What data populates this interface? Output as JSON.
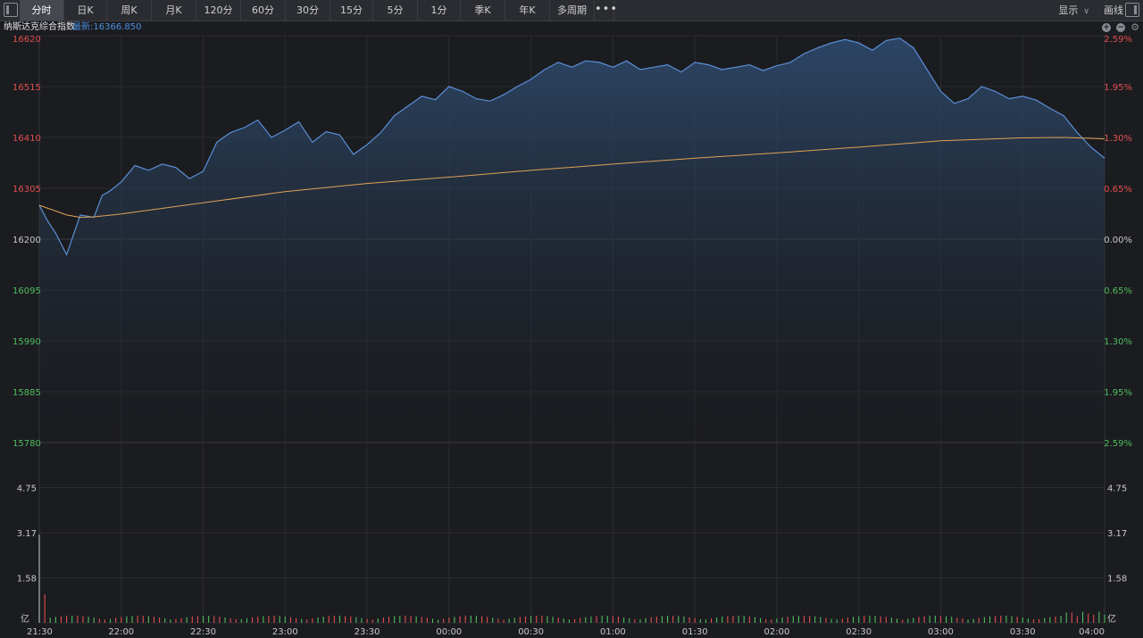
{
  "toolbar": {
    "tabs": [
      "分时",
      "日K",
      "周K",
      "月K",
      "120分",
      "60分",
      "30分",
      "15分",
      "5分",
      "1分",
      "季K",
      "年K",
      "多周期"
    ],
    "active_tab": "分时",
    "more_icon": "more-dots-icon",
    "display_label": "显示",
    "draw_label": "画线"
  },
  "info": {
    "index_name": "纳斯达克综合指数",
    "latest_label": "最新:16366.850"
  },
  "colors": {
    "background": "#1b1c20",
    "price_line": "#5b8fd6",
    "avg_line": "#e0a257",
    "up": "#e14f4f",
    "down": "#4fbe5f",
    "axis_text": "#c8c8c8",
    "latest_text": "#4a90e2"
  },
  "chart_data": {
    "type": "line",
    "title": "纳斯达克综合指数",
    "x_ticks": [
      "21:30",
      "22:00",
      "22:30",
      "23:00",
      "23:30",
      "00:00",
      "00:30",
      "01:00",
      "01:30",
      "02:00",
      "02:30",
      "03:00",
      "03:30",
      "04:00"
    ],
    "x_range": [
      "21:30",
      "04:00"
    ],
    "price_ticks": [
      "16620",
      "16515",
      "16410",
      "16305",
      "16200",
      "16095",
      "15990",
      "15885",
      "15780"
    ],
    "percent_ticks": [
      "2.59%",
      "1.95%",
      "1.30%",
      "0.65%",
      "0.00%",
      "0.65%",
      "1.30%",
      "1.95%",
      "2.59%"
    ],
    "ylim": [
      15780,
      16620
    ],
    "base_price": 16200,
    "volume_ticks": [
      "4.75",
      "3.17",
      "1.58",
      "亿"
    ],
    "volume_unit": "亿",
    "volume_ylim": [
      0,
      6.33
    ],
    "grid": true,
    "series": [
      {
        "type": "area",
        "x": [
          "21:30",
          "21:33",
          "21:36",
          "21:40",
          "21:45",
          "21:50",
          "21:53",
          "21:56",
          "22:00",
          "22:05",
          "22:10",
          "22:15",
          "22:20",
          "22:25",
          "22:30",
          "22:35",
          "22:40",
          "22:45",
          "22:50",
          "22:55",
          "23:00",
          "23:05",
          "23:10",
          "23:15",
          "23:20",
          "23:25",
          "23:30",
          "23:35",
          "23:40",
          "23:45",
          "23:50",
          "23:55",
          "00:00",
          "00:05",
          "00:10",
          "00:15",
          "00:20",
          "00:25",
          "00:30",
          "00:35",
          "00:40",
          "00:45",
          "00:50",
          "00:55",
          "01:00",
          "01:05",
          "01:10",
          "01:15",
          "01:20",
          "01:25",
          "01:30",
          "01:35",
          "01:40",
          "01:45",
          "01:50",
          "01:55",
          "02:00",
          "02:05",
          "02:10",
          "02:15",
          "02:20",
          "02:25",
          "02:30",
          "02:35",
          "02:40",
          "02:45",
          "02:50",
          "02:55",
          "03:00",
          "03:05",
          "03:10",
          "03:15",
          "03:20",
          "03:25",
          "03:30",
          "03:35",
          "03:40",
          "03:45",
          "03:50",
          "03:55",
          "04:00"
        ],
        "values": [
          16270,
          16238,
          16212,
          16168,
          16250,
          16245,
          16290,
          16300,
          16318,
          16352,
          16342,
          16355,
          16348,
          16325,
          16340,
          16400,
          16420,
          16430,
          16446,
          16410,
          16425,
          16442,
          16400,
          16422,
          16415,
          16375,
          16395,
          16420,
          16455,
          16475,
          16495,
          16488,
          16515,
          16505,
          16490,
          16485,
          16498,
          16515,
          16530,
          16550,
          16565,
          16555,
          16568,
          16565,
          16555,
          16568,
          16550,
          16555,
          16560,
          16545,
          16565,
          16560,
          16550,
          16555,
          16560,
          16548,
          16558,
          16565,
          16583,
          16595,
          16605,
          16612,
          16605,
          16590,
          16610,
          16615,
          16595,
          16550,
          16505,
          16480,
          16490,
          16515,
          16505,
          16490,
          16495,
          16487,
          16470,
          16455,
          16420,
          16390,
          16367
        ],
        "color": "#5b8fd6"
      },
      {
        "type": "line",
        "x": [
          "21:30",
          "21:35",
          "21:40",
          "21:45",
          "21:50",
          "22:00",
          "22:30",
          "23:00",
          "23:30",
          "00:00",
          "00:30",
          "01:00",
          "01:30",
          "02:00",
          "02:30",
          "03:00",
          "03:30",
          "03:45",
          "04:00"
        ],
        "values": [
          16270,
          16260,
          16250,
          16245,
          16246,
          16252,
          16275,
          16298,
          16315,
          16328,
          16342,
          16355,
          16367,
          16378,
          16390,
          16403,
          16409,
          16410,
          16407
        ],
        "color": "#e0a257"
      }
    ],
    "volume": {
      "first": 3.1,
      "second": 1.0,
      "typical": 0.18,
      "last": 0.3
    }
  }
}
